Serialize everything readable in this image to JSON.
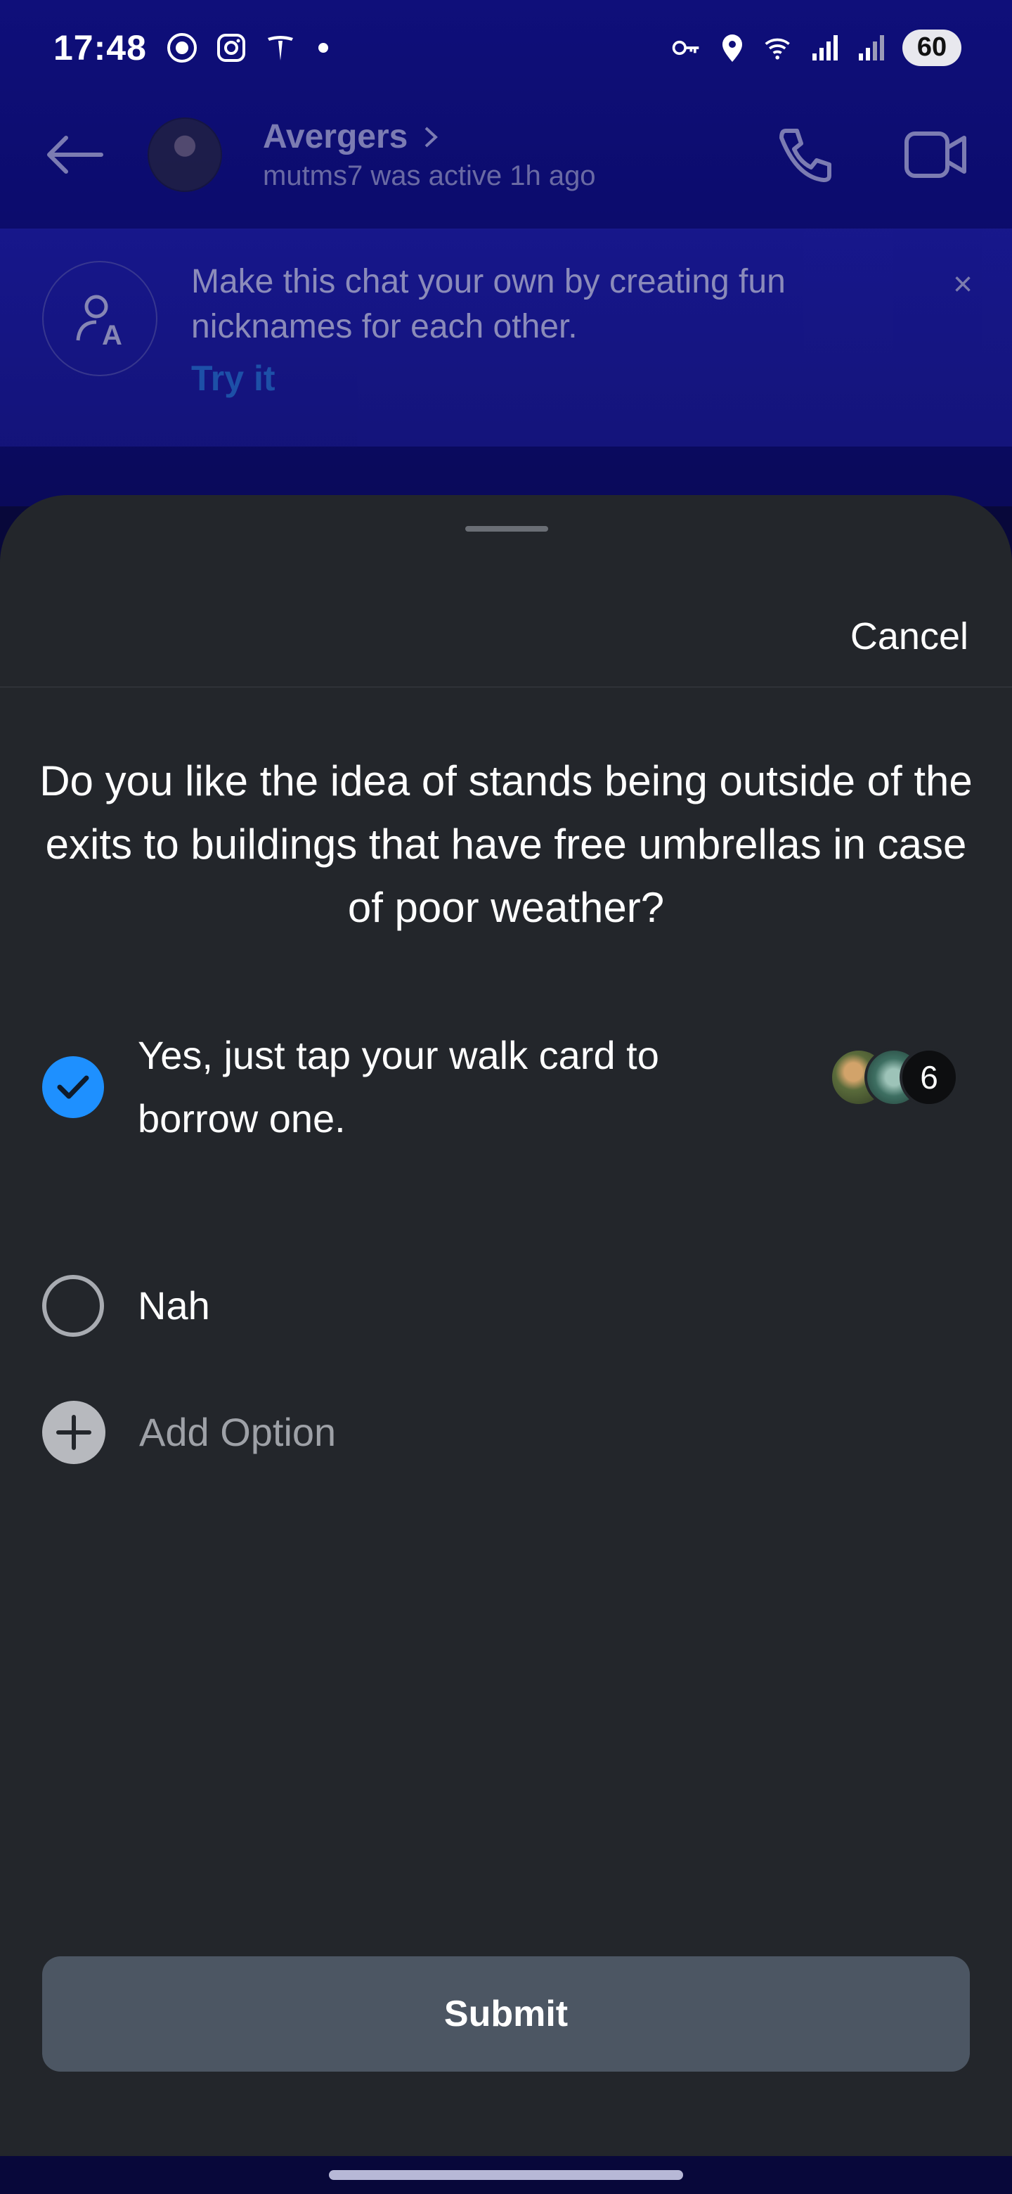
{
  "status_bar": {
    "time": "17:48",
    "battery": "60",
    "left_icons": [
      "duckduckgo-icon",
      "instagram-icon",
      "tesla-icon",
      "notification-dot"
    ],
    "right_icons": [
      "vpn-key-icon",
      "location-icon",
      "wifi-icon",
      "signal-icon",
      "signal-icon-2"
    ]
  },
  "chat_header": {
    "title": "Avergers",
    "subtitle": "mutms7 was active 1h ago"
  },
  "nickname_banner": {
    "text": "Make this chat your own by creating fun nicknames for each other.",
    "action": "Try it",
    "close": "×"
  },
  "poll_sheet": {
    "cancel_label": "Cancel",
    "question": "Do you like the idea of stands being outside of the exits to buildings that have free umbrellas in case of poor weather?",
    "options": [
      {
        "label": "Yes, just tap your walk card to borrow one.",
        "selected": true,
        "vote_count": "6"
      },
      {
        "label": "Nah",
        "selected": false
      }
    ],
    "add_option_label": "Add Option",
    "submit_label": "Submit"
  },
  "colors": {
    "accent": "#1e90ff",
    "sheet_bg": "#23262b",
    "submit_bg": "#4c5663",
    "header_bg": "#0f0f7a"
  }
}
